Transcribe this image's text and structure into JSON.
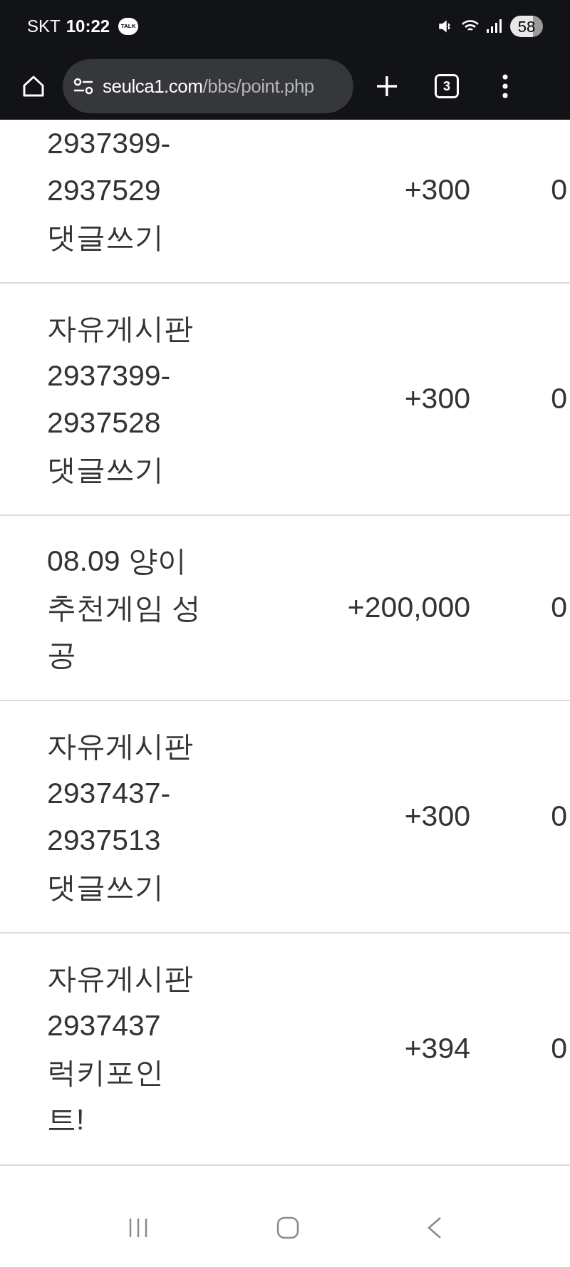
{
  "status_bar": {
    "carrier": "SKT",
    "time": "10:22",
    "notification": "TALK",
    "battery": "58"
  },
  "browser": {
    "url_host": "seulca1.com",
    "url_path": "/bbs/point.php",
    "tab_count": "3"
  },
  "rows": [
    {
      "title_lines": [
        "2937399-",
        "2937529",
        "댓글쓰기"
      ],
      "points": "+300",
      "balance": "0"
    },
    {
      "title_lines": [
        "자유게시판",
        "2937399-",
        "2937528",
        "댓글쓰기"
      ],
      "points": "+300",
      "balance": "0"
    },
    {
      "title_lines": [
        "08.09 양이",
        "추천게임 성",
        "공"
      ],
      "points": "+200,000",
      "balance": "0"
    },
    {
      "title_lines": [
        "자유게시판",
        "2937437-",
        "2937513",
        "댓글쓰기"
      ],
      "points": "+300",
      "balance": "0"
    },
    {
      "title_lines": [
        "자유게시판",
        "2937437",
        "럭키포인",
        "트!"
      ],
      "points": "+394",
      "balance": "0"
    }
  ]
}
